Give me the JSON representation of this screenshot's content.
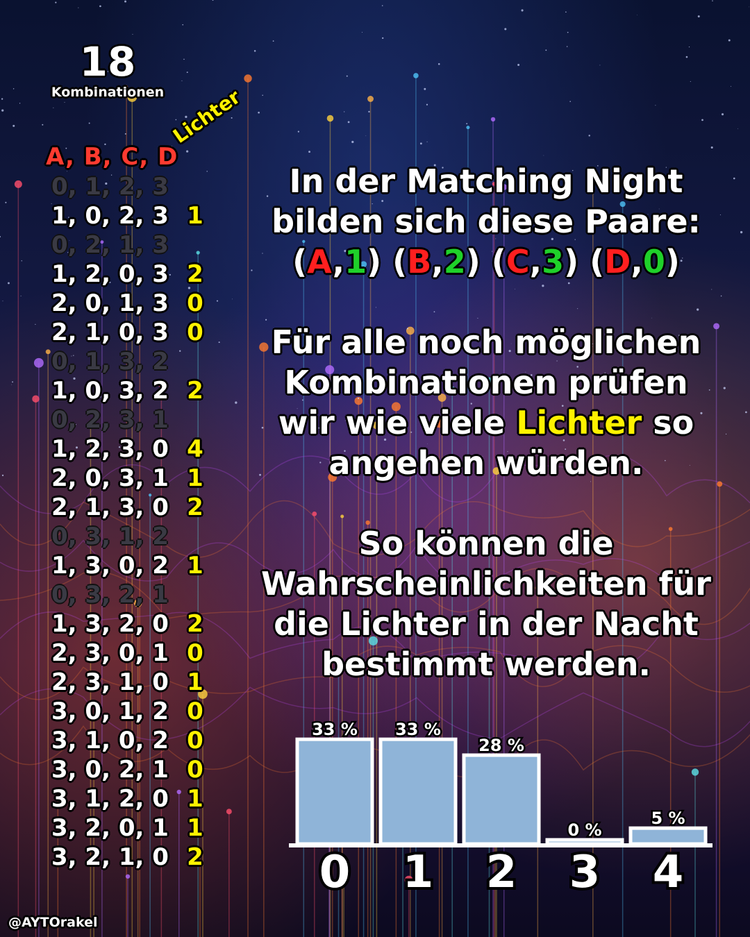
{
  "count": {
    "value": "18",
    "label": "Kombinationen"
  },
  "table": {
    "header_letters": "A, B, C, D",
    "header_lights": "Lichter",
    "rows": [
      {
        "combo": "0, 1, 2, 3",
        "lights": "",
        "excluded": true
      },
      {
        "combo": "1, 0, 2, 3",
        "lights": "1",
        "excluded": false
      },
      {
        "combo": "0, 2, 1, 3",
        "lights": "",
        "excluded": true
      },
      {
        "combo": "1, 2, 0, 3",
        "lights": "2",
        "excluded": false
      },
      {
        "combo": "2, 0, 1, 3",
        "lights": "0",
        "excluded": false
      },
      {
        "combo": "2, 1, 0, 3",
        "lights": "0",
        "excluded": false
      },
      {
        "combo": "0, 1, 3, 2",
        "lights": "",
        "excluded": true
      },
      {
        "combo": "1, 0, 3, 2",
        "lights": "2",
        "excluded": false
      },
      {
        "combo": "0, 2, 3, 1",
        "lights": "",
        "excluded": true
      },
      {
        "combo": "1, 2, 3, 0",
        "lights": "4",
        "excluded": false
      },
      {
        "combo": "2, 0, 3, 1",
        "lights": "1",
        "excluded": false
      },
      {
        "combo": "2, 1, 3, 0",
        "lights": "2",
        "excluded": false
      },
      {
        "combo": "0, 3, 1, 2",
        "lights": "",
        "excluded": true
      },
      {
        "combo": "1, 3, 0, 2",
        "lights": "1",
        "excluded": false
      },
      {
        "combo": "0, 3, 2, 1",
        "lights": "",
        "excluded": true
      },
      {
        "combo": "1, 3, 2, 0",
        "lights": "2",
        "excluded": false
      },
      {
        "combo": "2, 3, 0, 1",
        "lights": "0",
        "excluded": false
      },
      {
        "combo": "2, 3, 1, 0",
        "lights": "1",
        "excluded": false
      },
      {
        "combo": "3, 0, 1, 2",
        "lights": "0",
        "excluded": false
      },
      {
        "combo": "3, 1, 0, 2",
        "lights": "0",
        "excluded": false
      },
      {
        "combo": "3, 0, 2, 1",
        "lights": "0",
        "excluded": false
      },
      {
        "combo": "3, 1, 2, 0",
        "lights": "1",
        "excluded": false
      },
      {
        "combo": "3, 2, 0, 1",
        "lights": "1",
        "excluded": false
      },
      {
        "combo": "3, 2, 1, 0",
        "lights": "2",
        "excluded": false
      }
    ]
  },
  "text": {
    "intro_line1": "In der Matching Night",
    "intro_line2": "bilden sich diese Paare:",
    "pairs": [
      {
        "letter": "A",
        "number": "1"
      },
      {
        "letter": "B",
        "number": "2"
      },
      {
        "letter": "C",
        "number": "3"
      },
      {
        "letter": "D",
        "number": "0"
      }
    ],
    "para2_line1": "Für alle noch möglichen",
    "para2_line2": "Kombinationen prüfen",
    "para2_line3_pre": "wir wie viele",
    "para2_line3_highlight": "Lichter",
    "para2_line3_post": "so",
    "para2_line4": "angehen würden.",
    "para3_line1": "So können die",
    "para3_line2": "Wahrscheinlichkeiten für",
    "para3_line3": "die Lichter in der Nacht",
    "para3_line4": "bestimmt werden."
  },
  "colors": {
    "letter": "#ff1f1f",
    "number": "#1fd12a",
    "highlight": "#fff200",
    "bar": "#8fb4d8"
  },
  "handle": "@AYTOrakel",
  "chart_data": {
    "type": "bar",
    "categories": [
      "0",
      "1",
      "2",
      "3",
      "4"
    ],
    "values": [
      33,
      33,
      28,
      0,
      5
    ],
    "value_labels": [
      "33 %",
      "33 %",
      "28 %",
      "0 %",
      "5 %"
    ],
    "ylim": [
      0,
      35
    ],
    "grid": false,
    "xlabel": "",
    "ylabel": ""
  }
}
